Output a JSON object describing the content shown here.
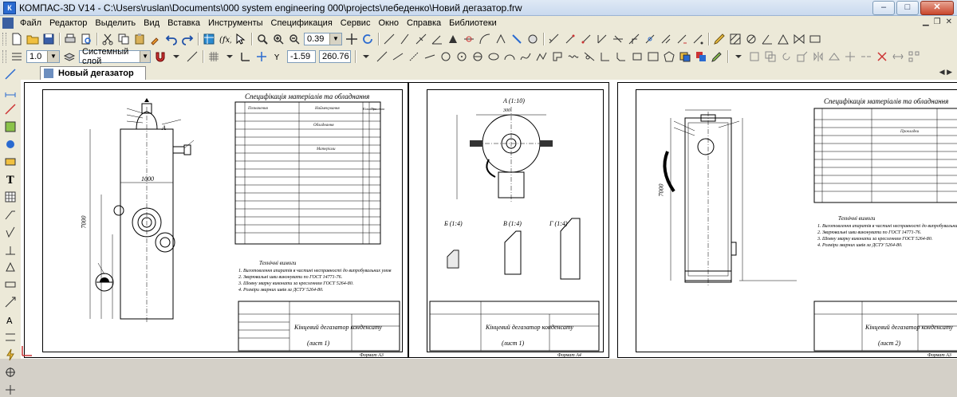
{
  "window": {
    "app_title": "КОМПАС-3D V14 - C:\\Users\\ruslan\\Documents\\000 system engineering 000\\projects\\лебеденко\\Новий дегазатор.frw",
    "minimize": "–",
    "maximize": "□",
    "close": "✕"
  },
  "menu": {
    "items": [
      "Файл",
      "Редактор",
      "Выделить",
      "Вид",
      "Вставка",
      "Инструменты",
      "Спецификация",
      "Сервис",
      "Окно",
      "Справка",
      "Библиотеки"
    ]
  },
  "toolbar1": {
    "zoom_value": "0.39"
  },
  "toolbar2": {
    "line_thickness": "1.0",
    "layer": "Системный слой",
    "coord_x": "-1.59",
    "coord_y": "260.76"
  },
  "document": {
    "tab_label": "Новый дегазатор"
  },
  "drawing": {
    "sheet1": {
      "spec_title": "Специфікація матеріалів та обладнання",
      "header": [
        "Позначення",
        "Найменування",
        "Кількість",
        "Примітка"
      ],
      "section_equipment": "Обладнання",
      "section_materials": "Матеріали",
      "stamp_name": "Кінцевий дегазатор конденсату",
      "stamp_sheet": "(лист 1)",
      "format": "Формат А3",
      "notes_title": "Технічні вимоги",
      "notes": [
        "1. Виготовлення апаратів в частині несправності до випробувальних умов",
        "2. Зварювальні шви виконувати по ГОСТ 14771-76.",
        "3. Шовну зварку виконати за кресленням ГОСТ 5264-80.",
        "4. Розміри зварних швів за ДСТУ 5264-80."
      ]
    },
    "sheet2": {
      "view_a": "А (1:10)",
      "view_b": "Б (1:4)",
      "view_v": "В (1:4)",
      "view_g": "Г (1:4)",
      "stamp_name": "Кінцевий дегазатор конденсату",
      "stamp_sheet": "(лист 1)",
      "format": "Формат А4"
    },
    "sheet3": {
      "spec_title": "Специфікація матеріалів та обладнання",
      "section": "Прокладки",
      "notes_title": "Технічні вимоги",
      "stamp_name": "Кінцевий дегазатор конденсату",
      "stamp_sheet": "(лист 2)",
      "format": "Формат А3"
    },
    "dims": {
      "height1": "7000",
      "width1": "1000",
      "height3": "7000",
      "d_top": "300",
      "a_pos": "А"
    }
  },
  "colors": {
    "accent": "#2a6ad0",
    "toolbar_bg": "#ece9d8",
    "canvas_bg": "#ffffff"
  }
}
